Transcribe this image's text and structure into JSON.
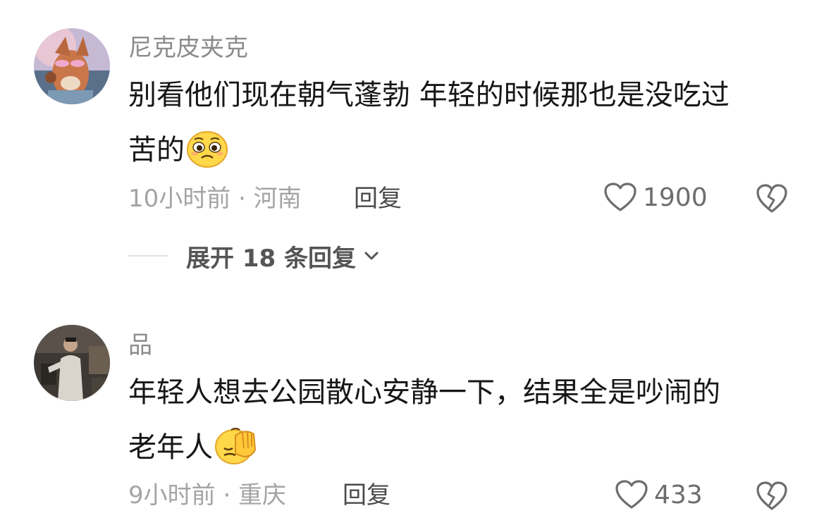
{
  "comments": [
    {
      "username": "尼克皮夹克",
      "text_line1": "别看他们现在朝气蓬勃 年轻的时候那也是没吃过",
      "text_line2": "苦的",
      "emoji": "pleading-face-emoji",
      "time": "10小时前",
      "location": "河南",
      "meta": "10小时前 · 河南",
      "reply_label": "回复",
      "likes": "1900",
      "expand_label": "展开 18 条回复"
    },
    {
      "username": "品",
      "text_line1": "年轻人想去公园散心安静一下，结果全是吵闹的",
      "text_line2": "老年人",
      "emoji": "facepalm-emoji",
      "time": "9小时前",
      "location": "重庆",
      "meta": "9小时前 · 重庆",
      "reply_label": "回复",
      "likes": "433"
    }
  ],
  "colors": {
    "username": "#8c8c8c",
    "text": "#161616",
    "meta": "#a4a4a4",
    "icon": "#6d6d6d"
  },
  "icons": {
    "like": "heart-outline-icon",
    "dislike": "broken-heart-icon",
    "expand": "chevron-down-icon"
  }
}
